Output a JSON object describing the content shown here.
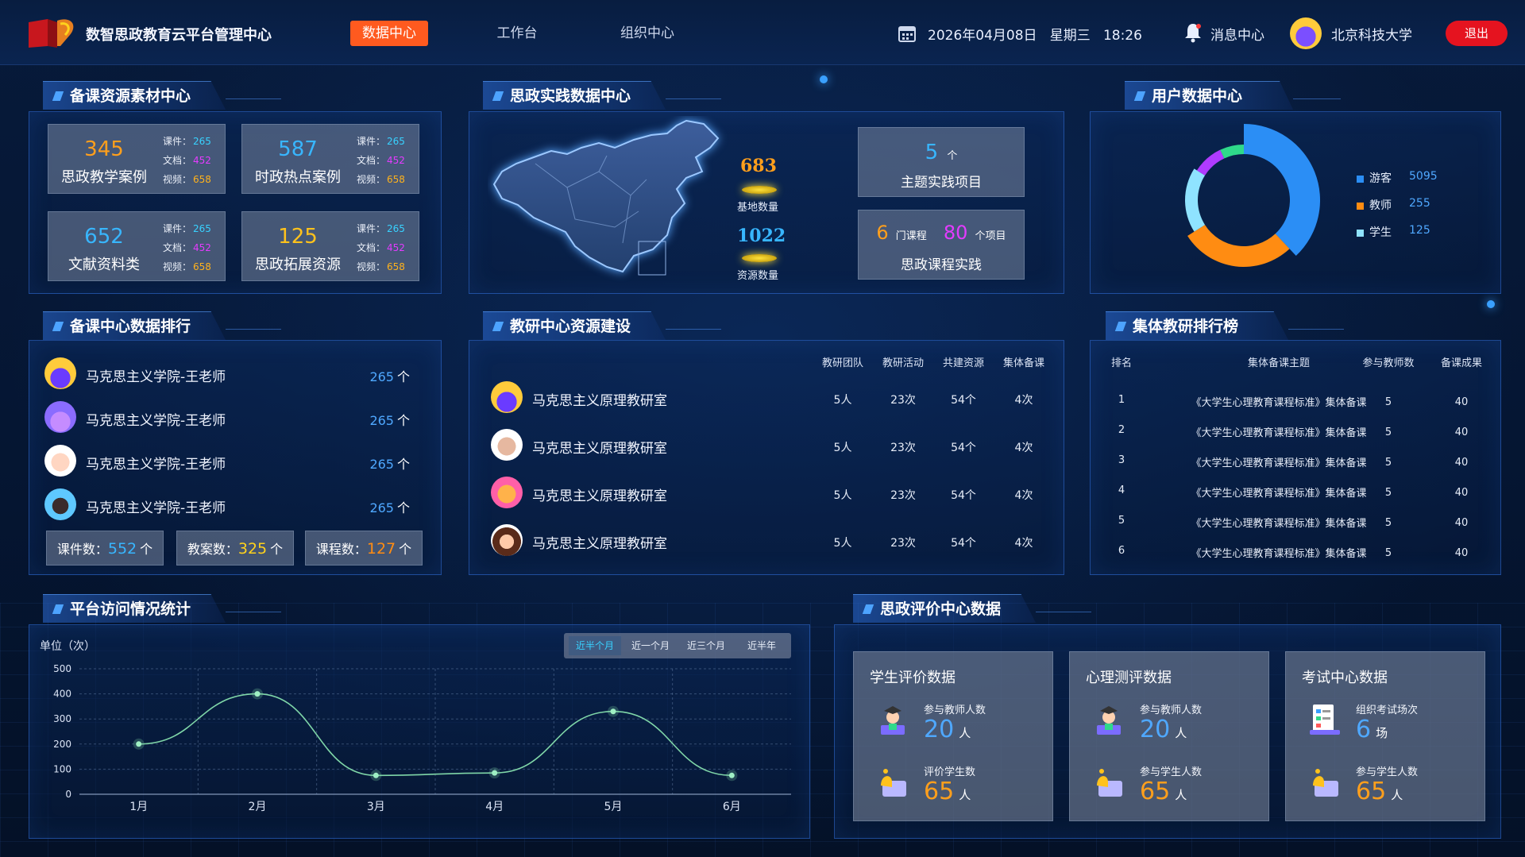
{
  "header": {
    "app_title": "数智思政教育云平台管理中心",
    "nav": [
      "数据中心",
      "工作台",
      "组织中心"
    ],
    "datetime": "2026年04月08日   星期三   18:26",
    "messages": "消息中心",
    "school": "北京科技大学",
    "logout": "退出"
  },
  "resources": {
    "title": "备课资源素材中心",
    "cards": [
      {
        "value": "345",
        "label": "思政教学案例",
        "color": "#ff9f1c",
        "courseware": "265",
        "docs": "452",
        "video": "658"
      },
      {
        "value": "587",
        "label": "时政热点案例",
        "color": "#38b6ff",
        "courseware": "265",
        "docs": "452",
        "video": "658"
      },
      {
        "value": "652",
        "label": "文献资料类",
        "color": "#38b6ff",
        "courseware": "265",
        "docs": "452",
        "video": "658"
      },
      {
        "value": "125",
        "label": "思政拓展资源",
        "color": "#ffc21c",
        "courseware": "265",
        "docs": "452",
        "video": "658"
      }
    ],
    "labels": {
      "courseware": "课件：",
      "docs": "文档：",
      "video": "视频："
    }
  },
  "practice": {
    "title": "思政实践数据中心",
    "base_count": "683",
    "base_label": "基地数量",
    "resource_count": "1022",
    "resource_label": "资源数量",
    "projects_value": "5",
    "projects_unit": "个",
    "projects_label": "主题实践项目",
    "course_value": "6",
    "course_unit": "门课程",
    "item_value": "80",
    "item_unit": "个项目",
    "course_label": "思政课程实践"
  },
  "users": {
    "title": "用户数据中心",
    "segments": [
      {
        "name": "游客",
        "value": 5095,
        "display": "5095",
        "color": "#2b8ef5"
      },
      {
        "name": "教师",
        "value": 255,
        "display": "255",
        "color": "#ff8c12"
      },
      {
        "name": "学生",
        "value": 125,
        "display": "125",
        "color": "#8fe3ff"
      }
    ]
  },
  "ranking": {
    "title": "备课中心数据排行",
    "rows": [
      {
        "name": "马克思主义学院-王老师",
        "value": "265",
        "unit": "个"
      },
      {
        "name": "马克思主义学院-王老师",
        "value": "265",
        "unit": "个"
      },
      {
        "name": "马克思主义学院-王老师",
        "value": "265",
        "unit": "个"
      },
      {
        "name": "马克思主义学院-王老师",
        "value": "265",
        "unit": "个"
      }
    ],
    "stats": [
      {
        "label": "课件数：",
        "value": "552",
        "unit": "个",
        "color": "#38b6ff"
      },
      {
        "label": "教案数：",
        "value": "325",
        "unit": "个",
        "color": "#ffd21c"
      },
      {
        "label": "课程数：",
        "value": "127",
        "unit": "个",
        "color": "#ff8c12"
      }
    ]
  },
  "research": {
    "title": "教研中心资源建设",
    "headers": [
      "教研团队",
      "教研活动",
      "共建资源",
      "集体备课"
    ],
    "rows": [
      {
        "name": "马克思主义原理教研室",
        "team": "5人",
        "activity": "23次",
        "shared": "54个",
        "collective": "4次"
      },
      {
        "name": "马克思主义原理教研室",
        "team": "5人",
        "activity": "23次",
        "shared": "54个",
        "collective": "4次"
      },
      {
        "name": "马克思主义原理教研室",
        "team": "5人",
        "activity": "23次",
        "shared": "54个",
        "collective": "4次"
      },
      {
        "name": "马克思主义原理教研室",
        "team": "5人",
        "activity": "23次",
        "shared": "54个",
        "collective": "4次"
      }
    ]
  },
  "collective": {
    "title": "集体教研排行榜",
    "headers": [
      "排名",
      "集体备课主题",
      "参与教师数",
      "备课成果"
    ],
    "rows": [
      {
        "rank": "1",
        "topic": "《大学生心理教育课程标准》集体备课",
        "teachers": "5",
        "results": "40"
      },
      {
        "rank": "2",
        "topic": "《大学生心理教育课程标准》集体备课",
        "teachers": "5",
        "results": "40"
      },
      {
        "rank": "3",
        "topic": "《大学生心理教育课程标准》集体备课",
        "teachers": "5",
        "results": "40"
      },
      {
        "rank": "4",
        "topic": "《大学生心理教育课程标准》集体备课",
        "teachers": "5",
        "results": "40"
      },
      {
        "rank": "5",
        "topic": "《大学生心理教育课程标准》集体备课",
        "teachers": "5",
        "results": "40"
      },
      {
        "rank": "6",
        "topic": "《大学生心理教育课程标准》集体备课",
        "teachers": "5",
        "results": "40"
      }
    ]
  },
  "visits": {
    "title": "平台访问情况统计",
    "unit_label": "单位（次）",
    "ranges": [
      "近半个月",
      "近一个月",
      "近三个月",
      "近半年"
    ],
    "active_range": 0
  },
  "chart_data": {
    "type": "line",
    "categories": [
      "1月",
      "2月",
      "3月",
      "4月",
      "5月",
      "6月"
    ],
    "values": [
      200,
      400,
      75,
      85,
      330,
      75
    ],
    "yticks": [
      "0",
      "100",
      "200",
      "300",
      "400",
      "500"
    ],
    "ylim": [
      0,
      500
    ],
    "grid": true,
    "line_color": "#7fd6a8"
  },
  "evaluation": {
    "title": "思政评价中心数据",
    "cards": [
      {
        "title": "学生评价数据",
        "l1": "参与教师人数",
        "v1": "20",
        "u1": "人",
        "l2": "评价学生数",
        "v2": "65",
        "u2": "人"
      },
      {
        "title": "心理测评数据",
        "l1": "参与教师人数",
        "v1": "20",
        "u1": "人",
        "l2": "参与学生人数",
        "v2": "65",
        "u2": "人"
      },
      {
        "title": "考试中心数据",
        "l1": "组织考试场次",
        "v1": "6",
        "u1": "场",
        "l2": "参与学生人数",
        "v2": "65",
        "u2": "人"
      }
    ]
  }
}
